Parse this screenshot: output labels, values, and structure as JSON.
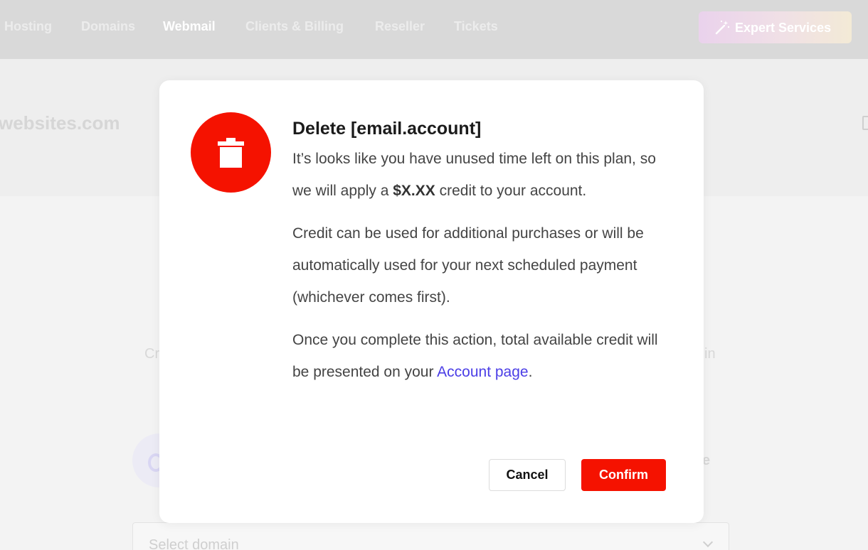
{
  "nav": {
    "items": [
      {
        "label": "Hosting",
        "active": false
      },
      {
        "label": "Domains",
        "active": false
      },
      {
        "label": "Webmail",
        "active": true
      },
      {
        "label": "Clients & Billing",
        "active": false
      },
      {
        "label": "Reseller",
        "active": false
      },
      {
        "label": "Tickets",
        "active": false
      }
    ],
    "expert_button": {
      "label": "Expert Services",
      "icon": "magic-wand-icon"
    }
  },
  "background": {
    "domain_title": "websites.com",
    "fragment_left": "Cr",
    "fragment_right": "in",
    "fragment_e": "e",
    "select_placeholder": "Select domain"
  },
  "modal": {
    "icon": "trash-icon",
    "title": "Delete [email.account]",
    "para1_before": "It’s looks like you have unused time left on this plan, so we will apply a ",
    "para1_amount": "$X.XX",
    "para1_after": " credit to your account.",
    "para2": "Credit can be used for additional purchases or will be automatically used for your next scheduled payment (whichever comes first).",
    "para3_before": "Once you complete this action, total available credit will be presented on your ",
    "para3_link": "Account page",
    "para3_after": ".",
    "cancel_label": "Cancel",
    "confirm_label": "Confirm"
  },
  "colors": {
    "danger": "#f51200",
    "link": "#4b3ee6",
    "overlay_nav": "#d9d9d9"
  }
}
